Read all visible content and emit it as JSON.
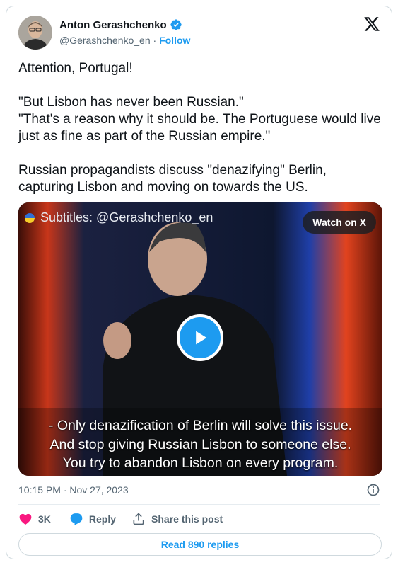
{
  "tweet": {
    "author": {
      "name": "Anton Gerashchenko",
      "handle": "@Gerashchenko_en",
      "separator": " · ",
      "follow_label": "Follow"
    },
    "text": "Attention, Portugal!\n\n\"But Lisbon has never been Russian.\"\n\"That's a reason why it should be. The Portuguese would live just as fine as part of the Russian empire.\"\n\nRussian propagandists discuss \"denazifying\" Berlin, capturing Lisbon and moving on towards the US.",
    "media": {
      "subtitle_watermark": "Subtitles: @Gerashchenko_en",
      "watch_label": "Watch on X",
      "caption_lines": [
        "- Only denazification of Berlin will solve this issue.",
        "And stop giving Russian Lisbon to someone else.",
        "You try to abandon Lisbon on every program."
      ]
    },
    "timestamp": "10:15 PM · Nov 27, 2023",
    "actions": {
      "likes": "3K",
      "reply_label": "Reply",
      "share_label": "Share this post"
    },
    "read_replies_label": "Read 890 replies"
  },
  "icons": [
    "verified-badge-icon",
    "x-logo-icon",
    "play-icon",
    "info-icon",
    "heart-icon",
    "reply-icon",
    "share-icon",
    "ukraine-flag-icon"
  ],
  "colors": {
    "accent": "#1d9bf0",
    "like": "#f91880",
    "text": "#0f1419",
    "secondary": "#536471",
    "border": "#cfd9de"
  }
}
